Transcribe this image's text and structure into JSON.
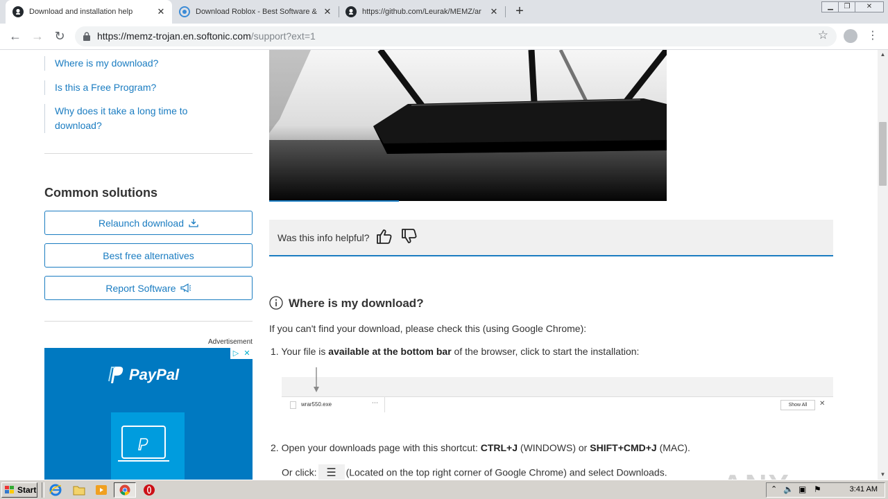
{
  "browser": {
    "tabs": [
      {
        "title": "Download and installation help",
        "active": true
      },
      {
        "title": "Download Roblox - Best Software &",
        "active": false
      },
      {
        "title": "https://github.com/Leurak/MEMZ/ar",
        "active": false
      }
    ],
    "url_host": "https://memz-trojan.en.softonic.com",
    "url_rest": "/support?ext=1"
  },
  "sidebar": {
    "toc_links": [
      "Where is my download?",
      "Is this a Free Program?",
      "Why does it take a long time to download?"
    ],
    "common_heading": "Common solutions",
    "buttons": {
      "relaunch": "Relaunch download",
      "alternatives": "Best free alternatives",
      "report": "Report Software"
    },
    "ad_label": "Advertisement",
    "ad_brand": "PayPal"
  },
  "main": {
    "feedback_question": "Was this info helpful?",
    "section_title": "Where is my download?",
    "intro": "If you can't find your download, please check this (using Google Chrome):",
    "step1_prefix": "1. Your file is ",
    "step1_bold": "available at the bottom bar",
    "step1_suffix": " of the browser, click to start the installation:",
    "dl_file": "wrar550.exe",
    "dl_show_all": "Show All",
    "step2_prefix": "2. Open your downloads page with this shortcut: ",
    "step2_bold1": "CTRL+J",
    "step2_mid": " (WINDOWS) or ",
    "step2_bold2": "SHIFT+CMD+J",
    "step2_suffix": " (MAC).",
    "step3_prefix": "Or click:",
    "step3_suffix": "(Located on the top right corner of Google Chrome) and select Downloads."
  },
  "watermark": "ANY RUN",
  "taskbar": {
    "start_label": "Start",
    "clock": "3:41 AM"
  }
}
